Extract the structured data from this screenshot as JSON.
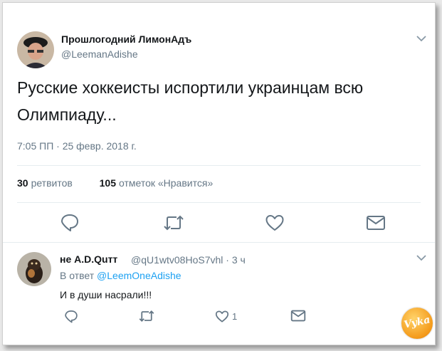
{
  "tweet": {
    "author_name": "Прошлогодний ЛимонАдъ",
    "author_handle": "@LeemanAdishe",
    "text_line1": "Русские хоккеисты испортили украинцам всю",
    "text_line2": "Олимпиаду...",
    "timestamp": "7:05 ПП · 25 февр. 2018 г.",
    "retweets_count": "30",
    "retweets_label": "ретвитов",
    "likes_count": "105",
    "likes_label": "отметок «Нравится»"
  },
  "reply": {
    "author_name": "не A.D.Quтт",
    "author_handle": "@qU1wtv08HoS7vhl",
    "age": "· 3 ч",
    "reply_to_prefix": "В ответ",
    "reply_to_handle": "@LeemOneAdishe",
    "text": "И в души насрали!!!",
    "like_count": "1"
  },
  "watermark": {
    "text": "Vyka"
  },
  "colors": {
    "icon": "#657786",
    "link": "#1da1f2",
    "text": "#14171a"
  }
}
